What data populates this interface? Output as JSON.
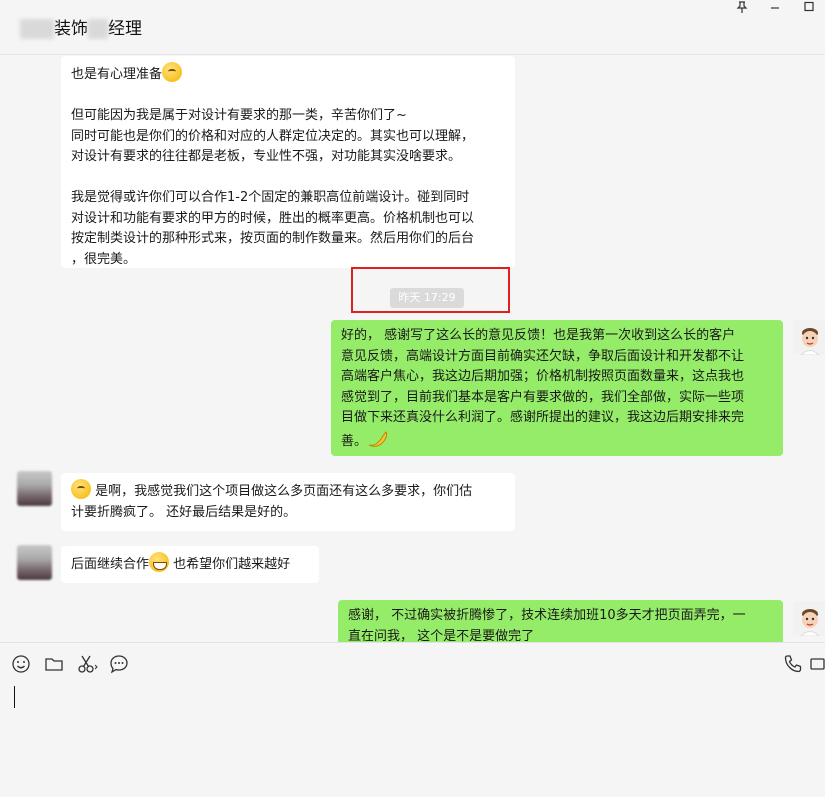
{
  "window": {
    "title_visible": "装饰",
    "title_suffix": "经理"
  },
  "messages": [
    {
      "side": "left",
      "lines": [
        "也是有心理准备",
        "",
        "但可能因为我是属于对设计有要求的那一类，辛苦你们了~",
        "同时可能也是你们的价格和对应的人群定位决定的。其实也可以理解，",
        "对设计有要求的往往都是老板，专业性不强，对功能其实没啥要求。",
        "",
        "我是觉得或许你们可以合作1-2个固定的兼职高位前端设计。碰到同时",
        "对设计和功能有要求的甲方的时候，胜出的概率更高。价格机制也可以",
        "按定制类设计的那种形式来，按页面的制作数量来。然后用你们的后台",
        "，很完美。"
      ]
    },
    {
      "side": "right",
      "lines": [
        "好的，  感谢写了这么长的意见反馈！也是我第一次收到这么长的客户",
        "意见反馈，高端设计方面目前确实还欠缺，争取后面设计和开发都不让",
        "高端客户焦心，我这边后期加强；价格机制按照页面数量来，这点我也",
        "感觉到了，目前我们基本是客户有要求做的，我们全部做，实际一些项",
        "目做下来还真没什么利润了。感谢所提出的建议，我这边后期安排来完",
        "善。"
      ]
    },
    {
      "side": "left",
      "lines": [
        "是啊，我感觉我们这个项目做这么多页面还有这么多要求，你们估",
        "计要折腾疯了。 还好最后结果是好的。"
      ]
    },
    {
      "side": "left",
      "text_before": "后面继续合作",
      "text_after": " 也希望你们越来越好"
    },
    {
      "side": "right",
      "lines": [
        "感谢，  不过确实被折腾惨了，技术连续加班10多天才把页面弄完，一",
        "直在问我，  这个是不是要做完了"
      ]
    }
  ],
  "timestamp": "昨天 17:29",
  "icons": {
    "pin": "pin-icon",
    "minimize": "minimize-icon",
    "maximize": "maximize-icon",
    "emoji": "emoji-icon",
    "folder": "folder-icon",
    "scissors": "scissors-icon",
    "chat_history": "chat-bubble-icon",
    "voice_call": "phone-icon",
    "video_call": "video-icon"
  },
  "colors": {
    "my_bubble": "#95ec69",
    "other_bubble": "#ffffff",
    "background": "#f5f5f5",
    "highlight_box": "#e02020"
  }
}
